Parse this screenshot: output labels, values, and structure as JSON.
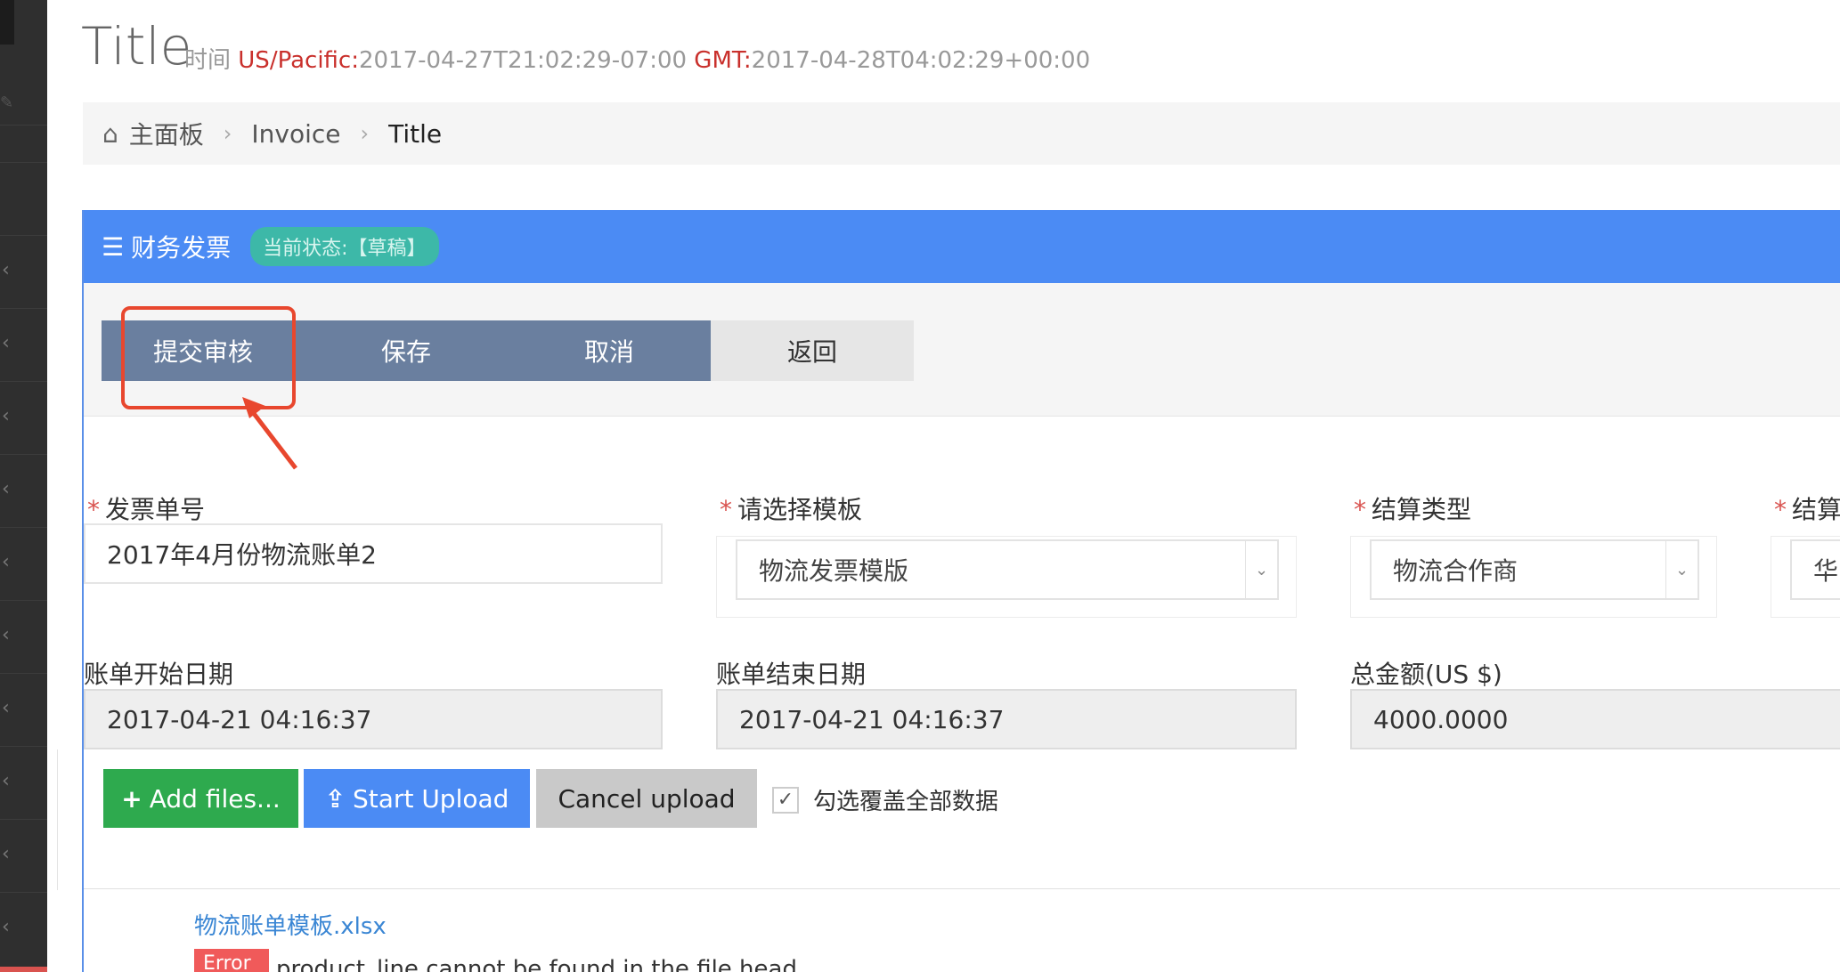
{
  "header": {
    "title": "Title",
    "time_label": "时间",
    "tz1_label": "US/Pacific:",
    "tz1_value": "2017-04-27T21:02:29-07:00",
    "tz2_label": "GMT:",
    "tz2_value": "2017-04-28T04:02:29+00:00"
  },
  "breadcrumb": {
    "home": "主面板",
    "level1": "Invoice",
    "current": "Title"
  },
  "panel": {
    "title": "财务发票",
    "status": "当前状态:【草稿】"
  },
  "toolbar": {
    "submit": "提交审核",
    "save": "保存",
    "cancel": "取消",
    "back": "返回"
  },
  "form": {
    "invoice_no_label": "发票单号",
    "invoice_no_value": "2017年4月份物流账单2",
    "template_label": "请选择模板",
    "template_value": "物流发票模版",
    "settle_type_label": "结算类型",
    "settle_type_value": "物流合作商",
    "settle_label_cut": "结算",
    "settle_value_cut": "华",
    "start_date_label": "账单开始日期",
    "start_date_value": "2017-04-21 04:16:37",
    "end_date_label": "账单结束日期",
    "end_date_value": "2017-04-21 04:16:37",
    "total_label": "总金额(US $)",
    "total_value": "4000.0000"
  },
  "upload": {
    "add_files": "Add files...",
    "start_upload": "Start Upload",
    "cancel_upload": "Cancel upload",
    "overwrite_label": "勾选覆盖全部数据",
    "overwrite_checked": true
  },
  "files": {
    "file_name": "物流账单模板.xlsx",
    "error_badge": "Error",
    "error_message": "product_line cannot be found in the file head"
  },
  "colors": {
    "panel_header": "#4b8bf4",
    "toolbar_button": "#6a7f9f",
    "add_button": "#2eaa4e",
    "highlight": "#e8472e"
  }
}
